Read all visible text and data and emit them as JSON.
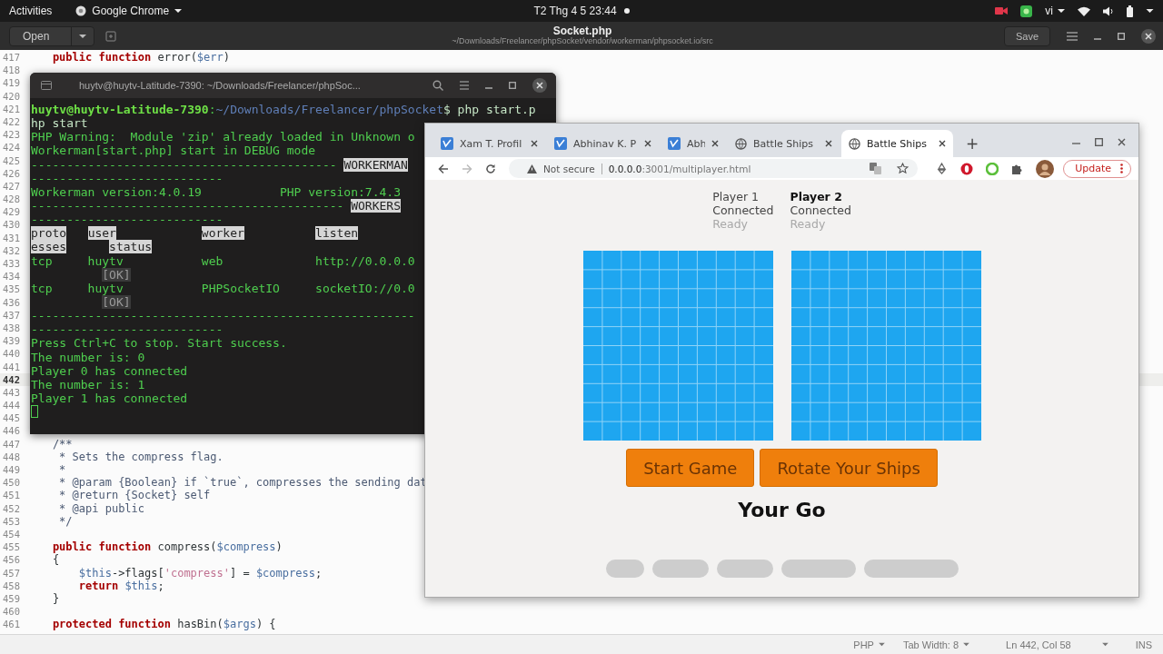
{
  "top_bar": {
    "activities": "Activities",
    "app_menu": "Google Chrome",
    "clock": "T2 Thg 4 5  23:44",
    "language": "vi"
  },
  "editor": {
    "open_button": "Open",
    "title": "Socket.php",
    "path": "~/Downloads/Freelancer/phpSocket/vendor/workerman/phpsocket.io/src",
    "save_button": "Save",
    "lines": [
      {
        "number": "417",
        "current": false,
        "code": [
          {
            "text": "    public function",
            "kind": "kw"
          },
          {
            "text": " error(",
            "kind": "plain"
          },
          {
            "text": "$err",
            "kind": "var"
          },
          {
            "text": ")",
            "kind": "plain"
          }
        ]
      },
      {
        "number": "418",
        "current": false
      },
      {
        "number": "419",
        "current": false
      },
      {
        "number": "420",
        "current": false
      },
      {
        "number": "421",
        "current": false
      },
      {
        "number": "422",
        "current": false
      },
      {
        "number": "423",
        "current": false
      },
      {
        "number": "424",
        "current": false
      },
      {
        "number": "425",
        "current": false
      },
      {
        "number": "426",
        "current": false
      },
      {
        "number": "427",
        "current": false
      },
      {
        "number": "428",
        "current": false
      },
      {
        "number": "429",
        "current": false
      },
      {
        "number": "430",
        "current": false
      },
      {
        "number": "431",
        "current": false
      },
      {
        "number": "432",
        "current": false
      },
      {
        "number": "433",
        "current": false
      },
      {
        "number": "434",
        "current": false
      },
      {
        "number": "435",
        "current": false
      },
      {
        "number": "436",
        "current": false
      },
      {
        "number": "437",
        "current": false
      },
      {
        "number": "438",
        "current": false
      },
      {
        "number": "439",
        "current": false
      },
      {
        "number": "440",
        "current": false
      },
      {
        "number": "441",
        "current": false
      },
      {
        "number": "442",
        "current": true
      },
      {
        "number": "443",
        "current": false
      },
      {
        "number": "444",
        "current": false
      },
      {
        "number": "445",
        "current": false
      },
      {
        "number": "446",
        "current": false
      },
      {
        "number": "447",
        "current": false,
        "code": [
          {
            "text": "    /**",
            "kind": "comment"
          }
        ]
      },
      {
        "number": "448",
        "current": false,
        "code": [
          {
            "text": "     * Sets the compress flag.",
            "kind": "comment"
          }
        ]
      },
      {
        "number": "449",
        "current": false,
        "code": [
          {
            "text": "     *",
            "kind": "comment"
          }
        ]
      },
      {
        "number": "450",
        "current": false,
        "code": [
          {
            "text": "     * @param {Boolean} if `true`, compresses the sending dat",
            "kind": "comment"
          }
        ]
      },
      {
        "number": "451",
        "current": false,
        "code": [
          {
            "text": "     * @return {Socket} self",
            "kind": "comment"
          }
        ]
      },
      {
        "number": "452",
        "current": false,
        "code": [
          {
            "text": "     * @api public",
            "kind": "comment"
          }
        ]
      },
      {
        "number": "453",
        "current": false,
        "code": [
          {
            "text": "     */",
            "kind": "comment"
          }
        ]
      },
      {
        "number": "454",
        "current": false
      },
      {
        "number": "455",
        "current": false,
        "code": [
          {
            "text": "    public function",
            "kind": "kw"
          },
          {
            "text": " compress(",
            "kind": "plain"
          },
          {
            "text": "$compress",
            "kind": "var"
          },
          {
            "text": ")",
            "kind": "plain"
          }
        ]
      },
      {
        "number": "456",
        "current": false,
        "code": [
          {
            "text": "    {",
            "kind": "plain"
          }
        ]
      },
      {
        "number": "457",
        "current": false,
        "code": [
          {
            "text": "        $this",
            "kind": "var"
          },
          {
            "text": "->flags[",
            "kind": "plain"
          },
          {
            "text": "'compress'",
            "kind": "str"
          },
          {
            "text": "] = ",
            "kind": "plain"
          },
          {
            "text": "$compress",
            "kind": "var"
          },
          {
            "text": ";",
            "kind": "plain"
          }
        ]
      },
      {
        "number": "458",
        "current": false,
        "code": [
          {
            "text": "        return",
            "kind": "kw"
          },
          {
            "text": " $this",
            "kind": "var"
          },
          {
            "text": ";",
            "kind": "plain"
          }
        ]
      },
      {
        "number": "459",
        "current": false,
        "code": [
          {
            "text": "    }",
            "kind": "plain"
          }
        ]
      },
      {
        "number": "460",
        "current": false
      },
      {
        "number": "461",
        "current": false,
        "code": [
          {
            "text": "    protected function",
            "kind": "kw"
          },
          {
            "text": " hasBin(",
            "kind": "plain"
          },
          {
            "text": "$args",
            "kind": "var"
          },
          {
            "text": ") {",
            "kind": "plain"
          }
        ]
      }
    ]
  },
  "status_bar": {
    "language": "PHP",
    "tab_width": "Tab Width: 8",
    "position": "Ln 442, Col 58",
    "mode": "INS"
  },
  "terminal": {
    "title": "huytv@huytv-Latitude-7390: ~/Downloads/Freelancer/phpSoc...",
    "lines": [
      [
        {
          "text": "huytv@huytv-Latitude-7390",
          "kind": "prompt"
        },
        {
          "text": ":",
          "kind": "plain"
        },
        {
          "text": "~/Downloads/Freelancer/phpSocket",
          "kind": "path"
        },
        {
          "text": "$ php start.p",
          "kind": "command"
        }
      ],
      [
        {
          "text": "hp start",
          "kind": "command"
        }
      ],
      [
        {
          "text": "PHP Warning:  Module 'zip' already loaded in Unknown o",
          "kind": "plain"
        }
      ],
      [
        {
          "text": "Workerman[start.php] start in DEBUG mode",
          "kind": "plain"
        }
      ],
      [
        {
          "text": "------------------------------------------- ",
          "kind": "plain"
        },
        {
          "text": "WORKERMAN",
          "kind": "label"
        }
      ],
      [
        {
          "text": "---------------------------",
          "kind": "plain"
        }
      ],
      [
        {
          "text": "Workerman version:4.0.19           PHP version:7.4.3",
          "kind": "plain"
        }
      ],
      [
        {
          "text": "-------------------------------------------- ",
          "kind": "plain"
        },
        {
          "text": "WORKERS",
          "kind": "label"
        }
      ],
      [
        {
          "text": "---------------------------",
          "kind": "plain"
        }
      ],
      [
        {
          "text": "proto   ",
          "kind": "label"
        },
        {
          "text": "user            ",
          "kind": "label"
        },
        {
          "text": "worker          ",
          "kind": "label"
        },
        {
          "text": "listen",
          "kind": "label"
        }
      ],
      [
        {
          "text": "esses      ",
          "kind": "label"
        },
        {
          "text": "status",
          "kind": "label"
        }
      ],
      [
        {
          "text": "tcp     huytv           web             http://0.0.0.0",
          "kind": "plain"
        }
      ],
      [
        {
          "text": "          [OK]",
          "kind": "dim"
        }
      ],
      [
        {
          "text": "tcp     huytv           PHPSocketIO     socketIO://0.0",
          "kind": "plain"
        }
      ],
      [
        {
          "text": "          [OK]",
          "kind": "dim"
        }
      ],
      [
        {
          "text": "------------------------------------------------------",
          "kind": "plain"
        }
      ],
      [
        {
          "text": "---------------------------",
          "kind": "plain"
        }
      ],
      [
        {
          "text": "Press Ctrl+C to stop. Start success.",
          "kind": "plain"
        }
      ],
      [
        {
          "text": "The number is: 0",
          "kind": "plain"
        }
      ],
      [
        {
          "text": "Player 0 has connected",
          "kind": "plain"
        }
      ],
      [
        {
          "text": "The number is: 1",
          "kind": "plain"
        }
      ],
      [
        {
          "text": "Player 1 has connected",
          "kind": "plain"
        }
      ]
    ]
  },
  "browser": {
    "tabs": [
      {
        "title": "Xam T. Profil",
        "kind": "app",
        "selected": false
      },
      {
        "title": "Abhinav K. P",
        "kind": "app",
        "selected": false
      },
      {
        "title": "Abh",
        "kind": "app",
        "selected": false
      },
      {
        "title": "Battle Ships",
        "kind": "web",
        "selected": false
      },
      {
        "title": "Battle Ships",
        "kind": "web",
        "selected": true
      }
    ],
    "new_tab": "+",
    "url": {
      "warning": "Not secure",
      "host": "0.0.0.0",
      "rest": ":3001/multiplayer.html"
    },
    "update_button": "Update",
    "page": {
      "players": [
        {
          "name": "Player 1",
          "you": false,
          "status": "Connected",
          "ready_label": "Ready",
          "ready": false
        },
        {
          "name": "Player 2",
          "you": true,
          "status": "Connected",
          "ready_label": "Ready",
          "ready": false
        }
      ],
      "buttons": [
        "Start Game",
        "Rotate Your Ships"
      ],
      "turn": "Your Go"
    }
  }
}
